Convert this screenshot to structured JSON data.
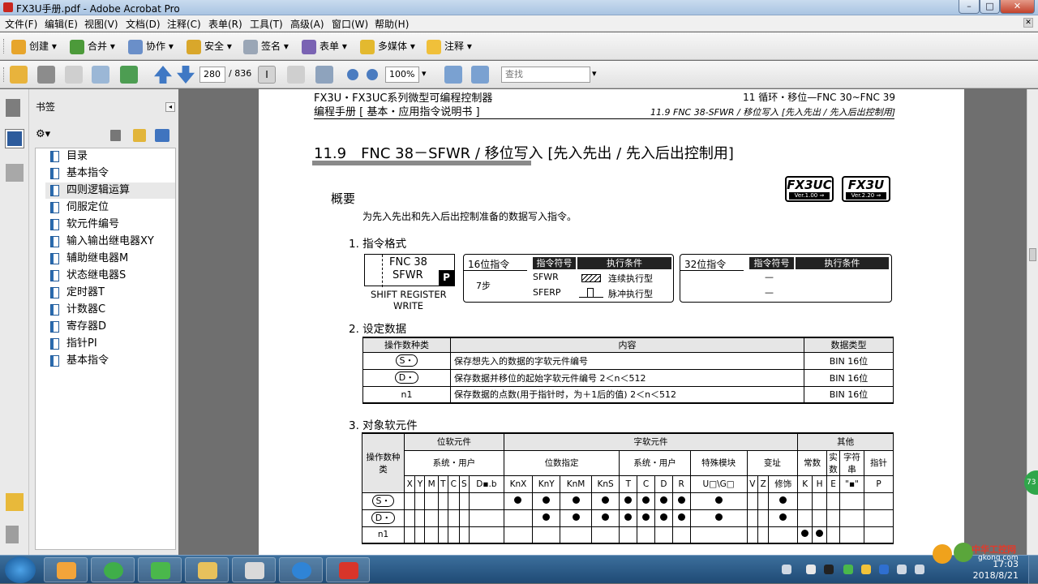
{
  "window": {
    "title": "FX3U手册.pdf - Adobe Acrobat Pro",
    "minimize": "–",
    "maximize": "□",
    "close": "✕"
  },
  "menu": [
    "文件(F)",
    "编辑(E)",
    "视图(V)",
    "文档(D)",
    "注释(C)",
    "表单(R)",
    "工具(T)",
    "高级(A)",
    "窗口(W)",
    "帮助(H)"
  ],
  "toolbar1": {
    "create": "创建",
    "combine": "合并",
    "collaborate": "协作",
    "secure": "安全",
    "sign": "签名",
    "forms": "表单",
    "multimedia": "多媒体",
    "comment": "注释"
  },
  "toolbar2": {
    "page_current": "280",
    "page_total": "/ 836",
    "zoom": "100%",
    "find_placeholder": "查找"
  },
  "sidebar": {
    "title": "书签",
    "items": [
      {
        "label": "目录"
      },
      {
        "label": "基本指令"
      },
      {
        "label": "四则逻辑运算"
      },
      {
        "label": "伺服定位"
      },
      {
        "label": "软元件编号"
      },
      {
        "label": "输入输出继电器XY"
      },
      {
        "label": "辅助继电器M"
      },
      {
        "label": "状态继电器S"
      },
      {
        "label": "定时器T"
      },
      {
        "label": "计数器C"
      },
      {
        "label": "寄存器D"
      },
      {
        "label": "指针PI"
      },
      {
        "label": "基本指令"
      }
    ]
  },
  "doc": {
    "header_left1": "FX3U・FX3UC系列微型可编程控制器",
    "header_left2": "编程手册 [ 基本・应用指令说明书 ]",
    "header_right1": "11 循环・移位—FNC 30~FNC 39",
    "header_right2": "11.9 FNC 38-SFWR / 移位写入 [先入先出 / 先入后出控制用]",
    "section_title": "11.9　FNC 38－SFWR / 移位写入 [先入先出 / 先入后出控制用]",
    "badge1": {
      "model": "FX3UC",
      "ver": "Ver.1.00 ⇒"
    },
    "badge2": {
      "model": "FX3U",
      "ver": "Ver.2.20 ⇒"
    },
    "overview_title": "概要",
    "overview_text": "为先入先出和先入后出控制准备的数据写入指令。",
    "s1_title": "1. 指令格式",
    "fnc_box": {
      "line1": "FNC 38",
      "line2": "SFWR",
      "p": "P",
      "caption1": "SHIFT REGISTER",
      "caption2": "WRITE"
    },
    "fmt16": {
      "title": "16位指令",
      "steps": "7步",
      "col_sym": "指令符号",
      "col_cond": "执行条件",
      "sym1": "SFWR",
      "cond1": "连续执行型",
      "sym2": "SFERP",
      "cond2": "脉冲执行型"
    },
    "fmt32": {
      "title": "32位指令",
      "col_sym": "指令符号",
      "col_cond": "执行条件",
      "dash1": "—",
      "dash2": "—"
    },
    "s2_title": "2. 设定数据",
    "setting_headers": [
      "操作数种类",
      "内容",
      "数据类型"
    ],
    "setting_rows": [
      {
        "op": "S・",
        "content": "保存想先入的数据的字软元件编号",
        "type": "BIN 16位"
      },
      {
        "op": "D・",
        "content": "保存数据并移位的起始字软元件编号 2＜n＜512",
        "type": "BIN 16位"
      },
      {
        "op": "n1",
        "content": "保存数据的点数(用于指针时，为＋1后的值) 2＜n＜512",
        "type": "BIN 16位"
      }
    ],
    "s3_title": "3. 对象软元件",
    "dev": {
      "op_header": "操作数种类",
      "g_bit": "位软元件",
      "g_word": "字软元件",
      "g_other": "其他",
      "sub_sys_user": "系统・用户",
      "sub_bit_spec": "位数指定",
      "sub_sys_user2": "系统・用户",
      "sub_special": "特殊模块",
      "sub_index": "变址",
      "sub_const": "常数",
      "sub_real": "实数",
      "sub_string": "字符串",
      "sub_pointer": "指针",
      "cols": [
        "X",
        "Y",
        "M",
        "T",
        "C",
        "S",
        "D▪.b",
        "KnX",
        "KnY",
        "KnM",
        "KnS",
        "T",
        "C",
        "D",
        "R",
        "U□\\G□",
        "V",
        "Z",
        "修饰",
        "K",
        "H",
        "E",
        "\"▪\"",
        "P"
      ],
      "rows": [
        {
          "op": "S・",
          "marks": [
            0,
            0,
            0,
            0,
            0,
            0,
            0,
            1,
            1,
            1,
            1,
            1,
            1,
            1,
            1,
            1,
            0,
            0,
            1,
            0,
            0,
            0,
            0,
            0
          ]
        },
        {
          "op": "D・",
          "marks": [
            0,
            0,
            0,
            0,
            0,
            0,
            0,
            0,
            1,
            1,
            1,
            1,
            1,
            1,
            1,
            1,
            0,
            0,
            1,
            0,
            0,
            0,
            0,
            0
          ]
        },
        {
          "op": "n1",
          "marks": [
            0,
            0,
            0,
            0,
            0,
            0,
            0,
            0,
            0,
            0,
            0,
            0,
            0,
            0,
            0,
            0,
            0,
            0,
            0,
            1,
            1,
            0,
            0,
            0
          ]
        }
      ]
    }
  },
  "float_badge": "73",
  "taskbar": {
    "time": "17:03",
    "date": "2018/8/21",
    "watermark": "中华工控网",
    "watermark_url": "gkong.com"
  }
}
